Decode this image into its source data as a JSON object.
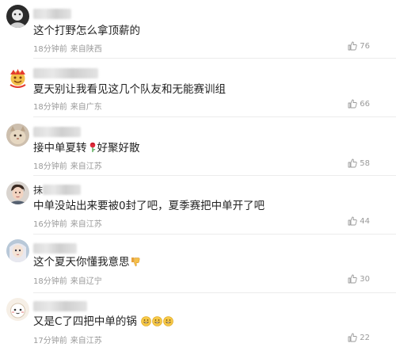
{
  "comments": [
    {
      "username_visible": "",
      "text": "这个打野怎么拿顶薪的",
      "time": "18分钟前",
      "location": "来自陕西",
      "likes": "76"
    },
    {
      "username_visible": "",
      "text": "夏天别让我看见这几个队友和无能赛训组",
      "time": "18分钟前",
      "location": "来自广东",
      "likes": "66"
    },
    {
      "username_visible": "",
      "text": "接中单夏转",
      "text_after_emoji": "好聚好散",
      "emoji": "rose-emoji",
      "time": "18分钟前",
      "location": "来自江苏",
      "likes": "58"
    },
    {
      "username_visible": "抹",
      "text": "中单没站出来要被0封了吧，夏季赛把中单开了吧",
      "time": "16分钟前",
      "location": "来自江苏",
      "likes": "44"
    },
    {
      "username_visible": "",
      "text": "这个夏天你懂我意思",
      "emoji": "thumbs-down-emoji",
      "time": "18分钟前",
      "location": "来自辽宁",
      "likes": "30"
    },
    {
      "username_visible": "",
      "text": "又是C了四把中单的锅",
      "emoji": "grin-emoji",
      "emoji_count": 3,
      "time": "17分钟前",
      "location": "来自江苏",
      "likes": "22"
    }
  ],
  "colors": {
    "text": "#222222",
    "meta": "#9a9a9a",
    "divider": "#ececec"
  }
}
